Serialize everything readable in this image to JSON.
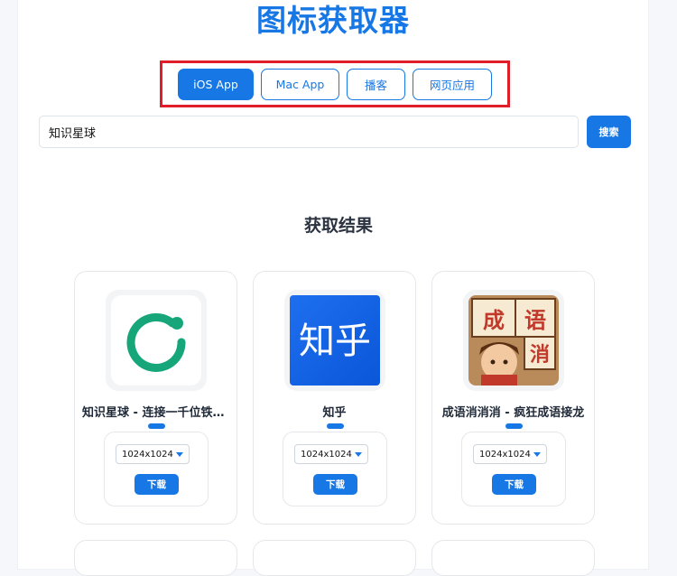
{
  "header": {
    "title": "图标获取器"
  },
  "tabs": [
    {
      "label": "iOS App",
      "active": true
    },
    {
      "label": "Mac App",
      "active": false
    },
    {
      "label": "播客",
      "active": false
    },
    {
      "label": "网页应用",
      "active": false
    }
  ],
  "search": {
    "value": "知识星球",
    "button_label": "搜索"
  },
  "results": {
    "title": "获取结果",
    "cards": [
      {
        "name": "知识星球 - 连接一千位铁杆粉丝",
        "size_option": "1024x1024",
        "download_label": "下载",
        "icon": "zsxq-icon"
      },
      {
        "name": "知乎",
        "size_option": "1024x1024",
        "download_label": "下载",
        "icon": "zhihu-icon",
        "icon_text": "知乎"
      },
      {
        "name": "成语消消消 - 疯狂成语接龙",
        "size_option": "1024x1024",
        "download_label": "下载",
        "icon": "chengyu-icon",
        "icon_chars": [
          "成",
          "语",
          "消"
        ]
      }
    ]
  },
  "colors": {
    "accent": "#1677e5",
    "highlight_frame": "#e01e2a",
    "zsxq_green": "#16a67a"
  }
}
